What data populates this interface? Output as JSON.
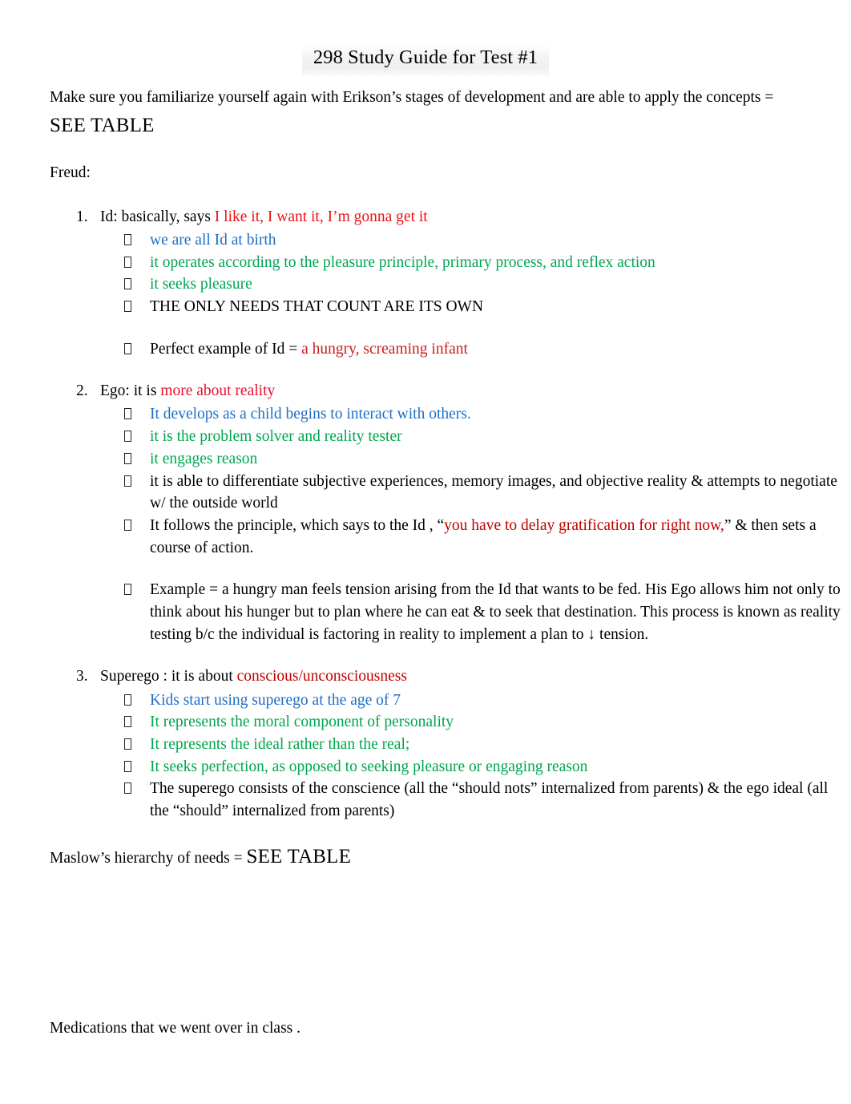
{
  "document": {
    "title": "298 Study Guide for Test #1",
    "intro": {
      "lead": "Make sure you familiarize yourself again with Erikson’s stages of development and are able to apply the concepts = ",
      "emphasis": "SEE TABLE"
    },
    "freud_heading": "Freud:",
    "maslow": {
      "lead": "Maslow’s hierarchy of needs = ",
      "emphasis": "SEE TABLE"
    },
    "medications": "Medications that we went over in class   ."
  },
  "colors": {
    "red_bright": "#ee1111",
    "red": "#e8112d",
    "red_dark": "#c62020",
    "red_deep": "#c00000",
    "green": "#00a650",
    "blue": "#1f6fc4",
    "black": "#000000",
    "page_background": "#ffffff",
    "title_highlight": "#efefef"
  },
  "icons": {
    "bullet": "missing-glyph-box"
  },
  "list": {
    "items": [
      {
        "number": "1.",
        "lead": "Id: basically, says ",
        "lead_colored": "I like it, I want it, I’m gonna get it",
        "bullets": [
          {
            "text": "we are all Id at birth",
            "color": "blue"
          },
          {
            "text": "it operates according to the pleasure principle, primary process, and reflex action",
            "color": "green"
          },
          {
            "text": "it seeks pleasure",
            "color": "green"
          },
          {
            "text": "THE ONLY NEEDS THAT COUNT ARE ITS OWN",
            "color": "black"
          }
        ],
        "extra_bullets": [
          {
            "prefix": "Perfect example of Id   = ",
            "colored": "a hungry, screaming infant",
            "color": "red_dark"
          }
        ]
      },
      {
        "number": "2.",
        "lead": "Ego: it is ",
        "lead_colored": "more about reality",
        "bullets": [
          {
            "text": "It develops as a child begins to interact with others.",
            "color": "blue"
          },
          {
            "text": "it is the problem solver and reality tester",
            "color": "green"
          },
          {
            "text": "it engages reason",
            "color": "green"
          },
          {
            "text": "it is able to differentiate subjective experiences, memory images, and objective reality & attempts to negotiate w/ the outside world",
            "color": "black"
          }
        ],
        "quote_bullet": {
          "before": "It follows the principle, which says to the Id , “",
          "quoted": "you have to delay gratification for right now,",
          "after": "” & then sets a course of action."
        },
        "example_bullet": "Example  = a hungry man feels tension arising from the Id  that wants to be fed. His Ego  allows him not only to think about his hunger but to plan where he can eat & to seek that destination. This process is known as reality testing b/c the individual is factoring in reality to implement a plan to ↓ tension."
      },
      {
        "number": "3.",
        "lead": "Superego : it is about ",
        "lead_colored": "conscious/unconsciousness",
        "bullets": [
          {
            "text": "Kids start using superego  at the age of 7",
            "color": "blue"
          },
          {
            "text": "It represents the moral component of personality",
            "color": "green"
          },
          {
            "text": "It represents the ideal rather than the real;",
            "color": "green"
          },
          {
            "text": "It seeks perfection, as opposed to seeking pleasure or engaging reason",
            "color": "green"
          },
          {
            "text": "The superego  consists of the conscience (all the “should nots” internalized from parents) & the ego ideal (all the “should” internalized from parents)",
            "color": "black"
          }
        ]
      }
    ]
  }
}
